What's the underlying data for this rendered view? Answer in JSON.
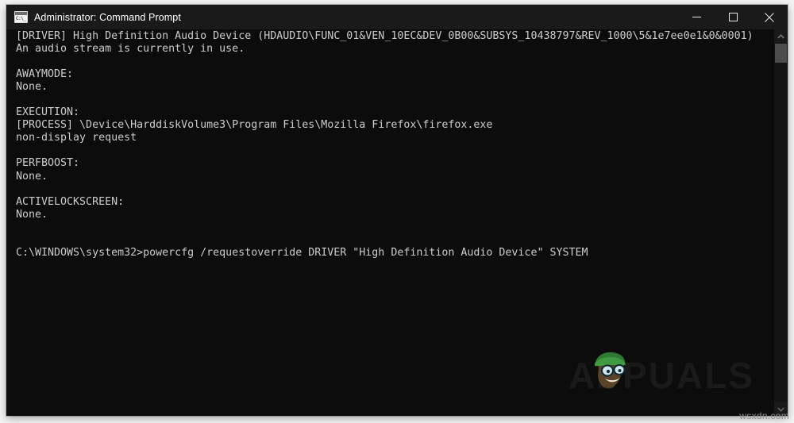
{
  "window": {
    "title": "Administrator: Command Prompt",
    "icon": "console-icon",
    "icon_glyph": "C:\\_",
    "colors": {
      "title_bar": "#1a1a1a",
      "console_background": "#0c0c0c",
      "console_foreground": "#cccccc",
      "page_background": "#f4f4f4",
      "scrollbar_track": "#141414",
      "scrollbar_thumb": "#4d4d4d"
    },
    "controls": {
      "minimize": "minimize-icon",
      "maximize": "maximize-icon",
      "close": "close-icon"
    }
  },
  "console": {
    "lines": [
      "[DRIVER] High Definition Audio Device (HDAUDIO\\FUNC_01&VEN_10EC&DEV_0B00&SUBSYS_10438797&REV_1000\\5&1e7ee0e1&0&0001)",
      "An audio stream is currently in use.",
      "",
      "AWAYMODE:",
      "None.",
      "",
      "EXECUTION:",
      "[PROCESS] \\Device\\HarddiskVolume3\\Program Files\\Mozilla Firefox\\firefox.exe",
      "non-display request",
      "",
      "PERFBOOST:",
      "None.",
      "",
      "ACTIVELOCKSCREEN:",
      "None.",
      "",
      "",
      "C:\\WINDOWS\\system32>powercfg /requestoverride DRIVER \"High Definition Audio Device\" SYSTEM"
    ],
    "prompt_path": "C:\\WINDOWS\\system32>",
    "command": "powercfg /requestoverride DRIVER \"High Definition Audio Device\" SYSTEM"
  },
  "scrollbar": {
    "up_arrow": "chevron-up-icon",
    "down_arrow": "chevron-down-icon"
  },
  "watermark": {
    "brand": "APPUALS",
    "site_credit": "wsxdn.com"
  }
}
